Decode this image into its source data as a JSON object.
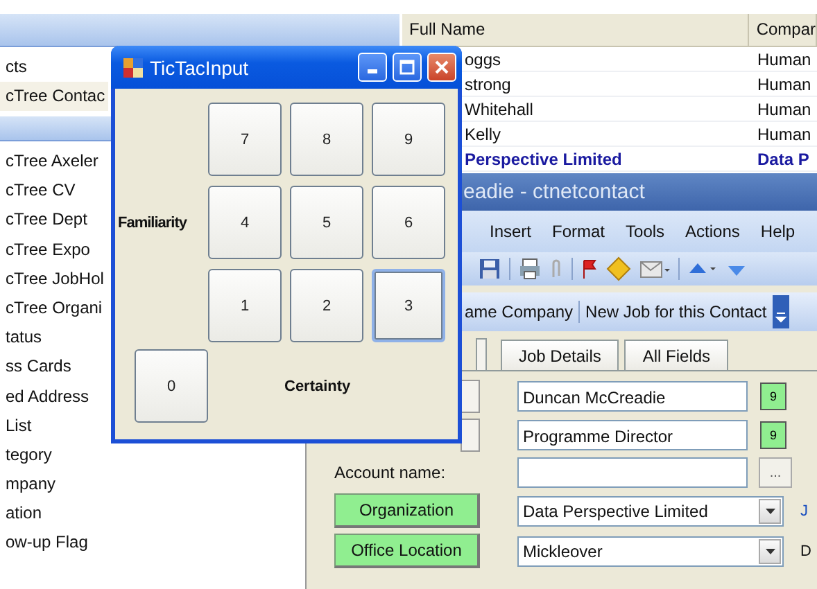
{
  "folders": {
    "groups": [
      {
        "items": [
          {
            "label": "cts",
            "selected": false
          },
          {
            "label": "cTree Contac",
            "selected": true
          }
        ]
      },
      {
        "items": [
          {
            "label": "cTree Axeler",
            "selected": false
          },
          {
            "label": "cTree CV",
            "selected": false
          },
          {
            "label": "cTree Dept",
            "selected": false
          },
          {
            "label": "cTree Expo",
            "selected": false
          },
          {
            "label": "cTree JobHol",
            "selected": false
          },
          {
            "label": "cTree Organi",
            "selected": false
          },
          {
            "label": "tatus",
            "selected": false
          },
          {
            "label": "ss Cards",
            "selected": false
          },
          {
            "label": "ed Address",
            "selected": false
          },
          {
            "label": "List",
            "selected": false
          },
          {
            "label": "tegory",
            "selected": false
          },
          {
            "label": "mpany",
            "selected": false
          },
          {
            "label": "ation",
            "selected": false
          },
          {
            "label": "ow-up Flag",
            "selected": false
          }
        ]
      }
    ]
  },
  "contacts": {
    "columns": [
      "Full Name",
      "Compar"
    ],
    "rows": [
      {
        "cells": [
          "oggs",
          "Human"
        ],
        "bold": false
      },
      {
        "cells": [
          "strong",
          "Human"
        ],
        "bold": false
      },
      {
        "cells": [
          "Whitehall",
          "Human"
        ],
        "bold": false
      },
      {
        "cells": [
          "Kelly",
          "Human"
        ],
        "bold": false
      },
      {
        "cells": [
          "Perspective Limited",
          "Data P"
        ],
        "bold": true
      }
    ]
  },
  "inspector": {
    "title": "eadie - ctnetcontact",
    "menu": [
      "Insert",
      "Format",
      "Tools",
      "Actions",
      "Help"
    ],
    "actions": [
      "ame Company",
      "New Job for this Contact"
    ],
    "tabs": [
      {
        "label": "Job Details",
        "selected": false
      },
      {
        "label": "All Fields",
        "selected": false
      }
    ],
    "fields": [
      {
        "kind": "text",
        "value": "Duncan McCreadie",
        "button": "9"
      },
      {
        "kind": "text",
        "value": "Programme Director",
        "button": "9"
      },
      {
        "kind": "lookup",
        "label": "Account name:",
        "button": "..."
      },
      {
        "kind": "combo",
        "button": "Organization",
        "value": "Data Perspective Limited",
        "note": "J"
      },
      {
        "kind": "combo",
        "button": "Office Location",
        "value": "Mickleover",
        "note": "D"
      }
    ]
  },
  "dialog": {
    "title": "TicTacInput",
    "keys": [
      {
        "label": "7",
        "focused": false
      },
      {
        "label": "8",
        "focused": false
      },
      {
        "label": "9",
        "focused": false
      },
      {
        "label": "4",
        "focused": false
      },
      {
        "label": "5",
        "focused": false
      },
      {
        "label": "6",
        "focused": false
      },
      {
        "label": "1",
        "focused": false
      },
      {
        "label": "2",
        "focused": false
      },
      {
        "label": "3",
        "focused": true
      }
    ],
    "zero": "0",
    "y_label": "Familiarity",
    "x_label": "Certainty"
  }
}
